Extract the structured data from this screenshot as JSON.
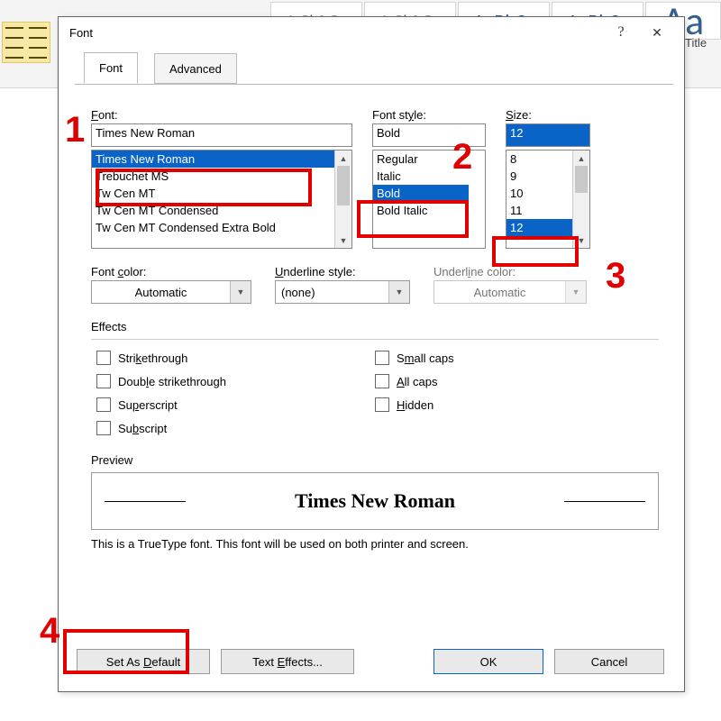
{
  "ribbon": {
    "styles": [
      "AaBbCcDc",
      "AaBbCcDc",
      "AaBbCc",
      "AaBbCc",
      "Aa"
    ],
    "title_label": "Title"
  },
  "dialog": {
    "title": "Font",
    "tabs": [
      "Font",
      "Advanced"
    ],
    "font": {
      "label": "Font:",
      "value": "Times New Roman",
      "list": [
        "Times New Roman",
        "Trebuchet MS",
        "Tw Cen MT",
        "Tw Cen MT Condensed",
        "Tw Cen MT Condensed Extra Bold"
      ]
    },
    "style": {
      "label": "Font style:",
      "value": "Bold",
      "list": [
        "Regular",
        "Italic",
        "Bold",
        "Bold Italic"
      ]
    },
    "size": {
      "label": "Size:",
      "value": "12",
      "list": [
        "8",
        "9",
        "10",
        "11",
        "12"
      ]
    },
    "fontColor": "Automatic",
    "underlineStyle": "(none)",
    "underlineColor": "Automatic",
    "effectsHeader": "Effects",
    "effects": [
      "Strikethrough",
      "Double strikethrough",
      "Superscript",
      "Subscript",
      "Small caps",
      "All caps",
      "Hidden"
    ],
    "previewHeader": "Preview",
    "previewText": "Times New Roman",
    "note": "This is a TrueType font. This font will be used on both printer and screen.",
    "buttons": {
      "setDefault": "Set As Default",
      "textEffects": "Text Effects...",
      "ok": "OK",
      "cancel": "Cancel"
    }
  },
  "annotations": [
    "1",
    "2",
    "3",
    "4"
  ],
  "colors": {
    "highlight": "#0a64c8",
    "annotation": "#e00000"
  }
}
